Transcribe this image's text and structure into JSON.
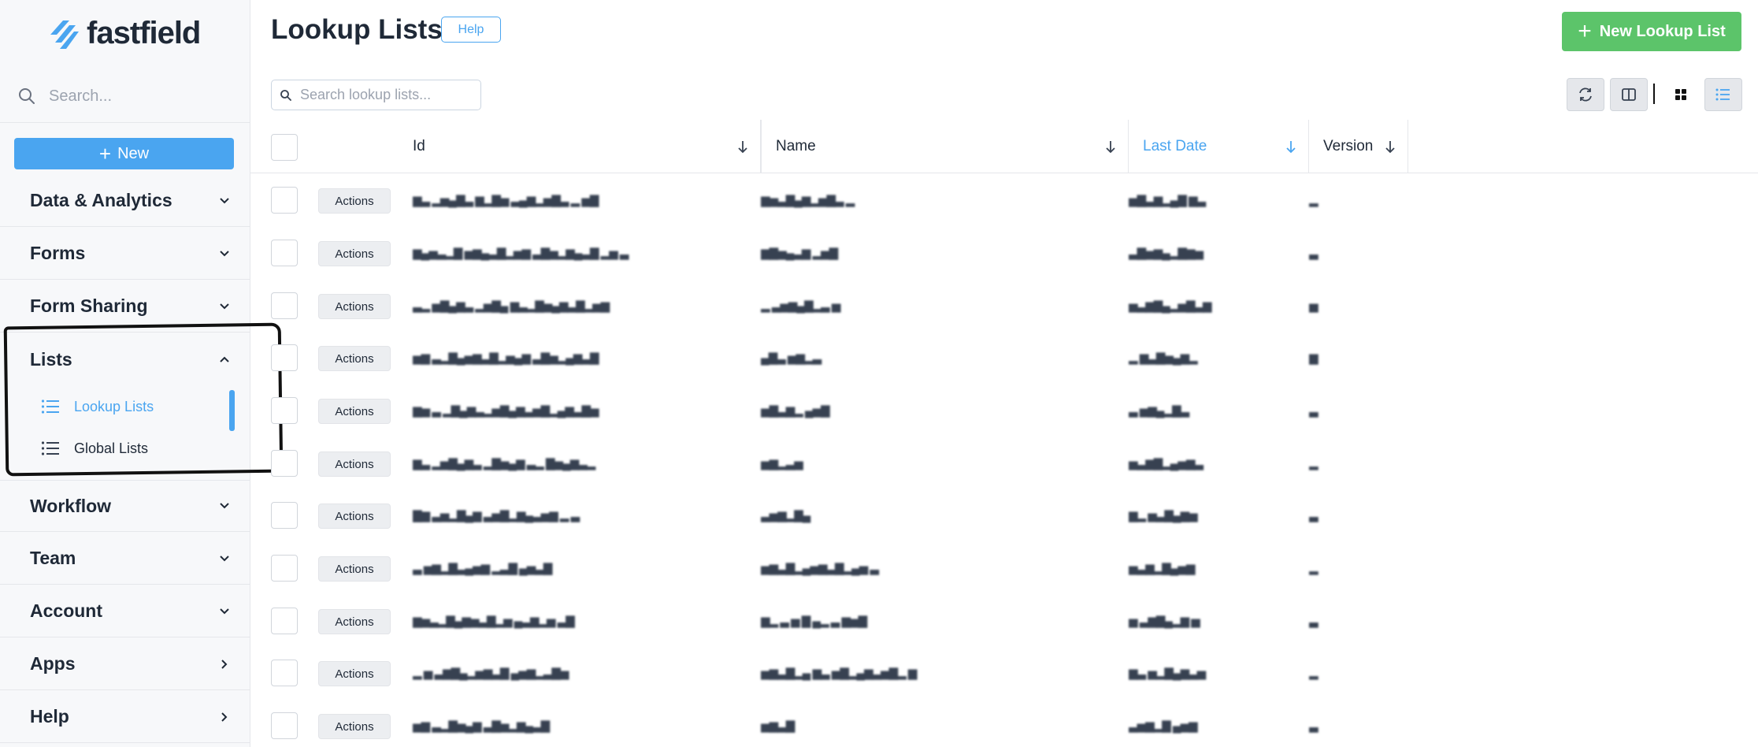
{
  "app": {
    "brand": "fastfield",
    "accent": "#4aa5f0",
    "success": "#5cc46a"
  },
  "sidebar": {
    "search_placeholder": "Search...",
    "new_label": "New",
    "sections": [
      {
        "label": "Data & Analytics",
        "icon": "chevron-down-icon"
      },
      {
        "label": "Forms",
        "icon": "chevron-down-icon"
      },
      {
        "label": "Form Sharing",
        "icon": "chevron-down-icon"
      },
      {
        "label": "Lists",
        "icon": "chevron-up-icon"
      },
      {
        "label": "Workflow",
        "icon": "chevron-down-icon"
      },
      {
        "label": "Team",
        "icon": "chevron-down-icon"
      },
      {
        "label": "Account",
        "icon": "chevron-down-icon"
      },
      {
        "label": "Apps",
        "icon": "chevron-right-icon"
      },
      {
        "label": "Help",
        "icon": "chevron-right-icon"
      }
    ],
    "lists_items": [
      {
        "label": "Lookup Lists",
        "active": true
      },
      {
        "label": "Global Lists",
        "active": false
      }
    ]
  },
  "header": {
    "title": "Lookup Lists",
    "help_label": "Help",
    "new_button_label": "New Lookup List",
    "search_placeholder": "Search lookup lists..."
  },
  "table": {
    "columns": [
      {
        "label": "Id",
        "sorted": false
      },
      {
        "label": "Name",
        "sorted": false
      },
      {
        "label": "Last Date",
        "sorted": true
      },
      {
        "label": "Version",
        "sorted": false
      }
    ],
    "action_label": "Actions",
    "rows": [
      {
        "id": "▆▃ ▂▅▄▇▃ ▆▂▇▅ ▃▄▆▂▅▇▃ ▂ ▅▇",
        "name": "▆▅▃▇▄▆▂▅▇▃ ▂",
        "date": "▅▇▃▆▂▄▇ ▆▃",
        "version": "▂"
      },
      {
        "id": "▆▄▅▃▂▇ ▅▆▄▃▇▂▅▆ ▃▇▅▂▆▄▃▇ ▂▅ ▃",
        "name": "▆▇▅▄▃▆ ▂▅▇",
        "date": "▃▇▅▆▄▂▇▆▅",
        "version": "▃"
      },
      {
        "id": "▃▂ ▅▇▄▆▃ ▂▅▇▄ ▆▃▂▇▅▄▆▃▇▂▅▆",
        "name": "▂ ▃▅▆▄▇▂▃ ▅",
        "date": "▅▃▆▇▄▂▅▇▃▆",
        "version": "▅"
      },
      {
        "id": "▅▆ ▃▂▇▄▅▆▃▇▂▅▄▆ ▃▇▅▂▄▆▃▇",
        "name": "▄▇▃ ▅▆▂▃",
        "date": "▂ ▆▃▇▅▄▆▂",
        "version": "▆"
      },
      {
        "id": "▆▅ ▃ ▂▇▄▆▃▂▅▇▄▆▃▅▇▂▄▆▃▇▅",
        "name": "▅▇▃▆▂ ▄▅▇",
        "date": "▃ ▅▆▄▂▇▃",
        "version": "▃"
      },
      {
        "id": "▆▃ ▂▅▇▄▆▃ ▂▇▅▄▆ ▃▂ ▇▅▄▆▃▂",
        "name": "▅▆▂▃▅",
        "date": "▅▃▆▇▂▄▅▆▃",
        "version": "▂"
      },
      {
        "id": "▇▆ ▃▅▂▇▄▆ ▃▅▇▂▆▄▃▅▆ ▂ ▃",
        "name": "▃▅▆▂▇▄",
        "date": "▆▂ ▅▃▇▄▆▅",
        "version": "▃"
      },
      {
        "id": "▃ ▅▆▂▇▃▄▅▆ ▂▃▇ ▄▅▃▇",
        "name": "▅▆▃▇▂▄▅▆▃▇▂▄▅ ▃",
        "date": "▅▃▆▂▇▄▅▆",
        "version": "▂"
      },
      {
        "id": "▆▅▃▂▇▄▆▅▃▇▂▅ ▄▃▆▂▅ ▃▇",
        "name": "▆▂ ▃ ▅ ▇ ▄▂ ▃ ▆▅▇",
        "date": "▅ ▃▆▇▄▂▆ ▅",
        "version": "▃"
      },
      {
        "id": "▂ ▅ ▃▆▇▄▂▅▆▃▇ ▄▅▆▂▃▇▅",
        "name": "▅▆▃▇▂▄ ▆▃ ▅▇▂▄▆▃▅▇▂ ▆",
        "date": "▆▃ ▅▂▇▄▆▃▅",
        "version": "▂"
      },
      {
        "id": "▅▆ ▃▂▇▅▄▆ ▃▇▅▂▆▄▃▇",
        "name": "▅▆▃▇",
        "date": "▃▅▆▂▇ ▄▅▆",
        "version": "▃"
      }
    ]
  }
}
